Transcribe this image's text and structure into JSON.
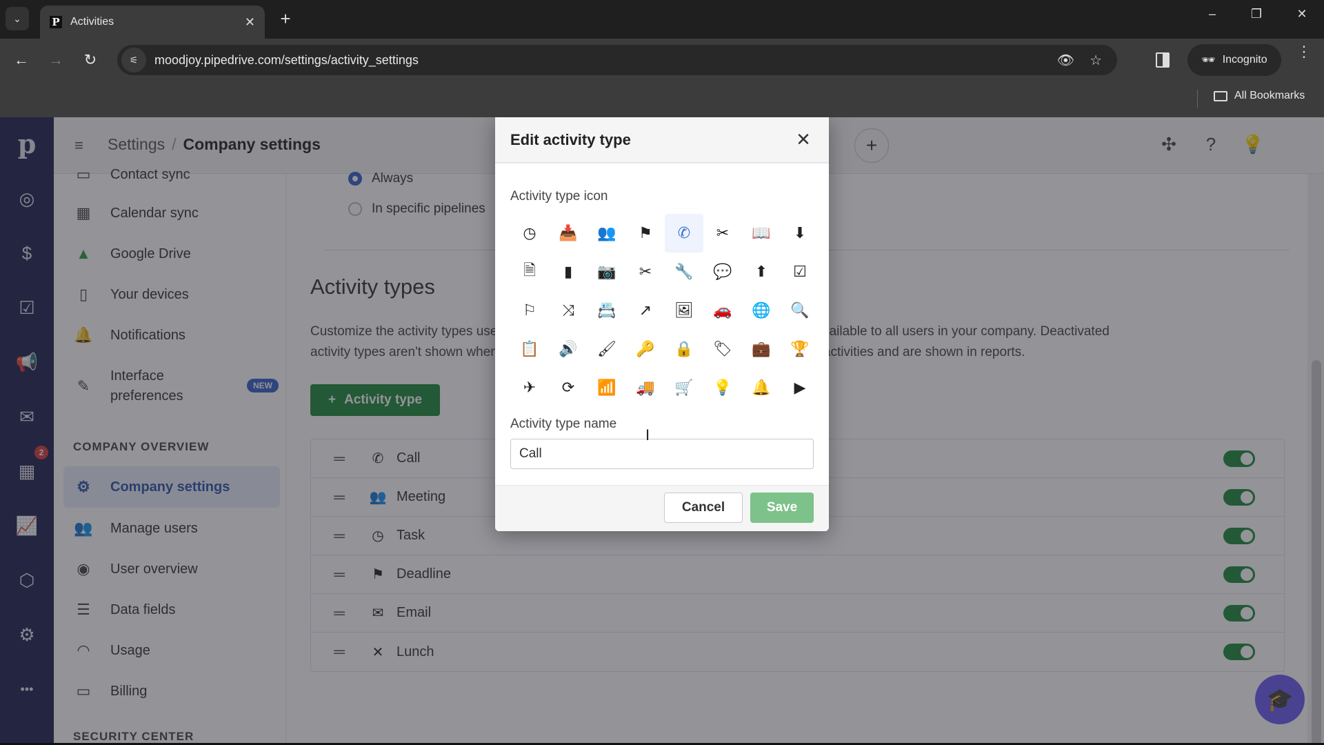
{
  "browser": {
    "tab_title": "Activities",
    "tab_favicon": "P",
    "url": "moodjoy.pipedrive.com/settings/activity_settings",
    "profile_label": "Incognito",
    "bookmarks_label": "All Bookmarks",
    "icons": {
      "tab_list": "⌄",
      "tab_close": "✕",
      "new_tab": "+",
      "minimize": "–",
      "restore": "❐",
      "close": "✕",
      "back": "←",
      "forward": "→",
      "reload": "↻",
      "site_settings": "⚟",
      "eye_off": "👁",
      "star": "☆",
      "kebab": "⋮"
    }
  },
  "header": {
    "breadcrumb_parent": "Settings",
    "breadcrumb_sep": "/",
    "breadcrumb_current": "Company settings",
    "icons": {
      "menu": "≡",
      "add": "+",
      "extensions": "✣",
      "help": "?",
      "ideas": "💡"
    }
  },
  "leftnav": {
    "logo": "p",
    "items": [
      {
        "name": "leads",
        "glyph": "◎"
      },
      {
        "name": "deals",
        "glyph": "$"
      },
      {
        "name": "projects",
        "glyph": "☑"
      },
      {
        "name": "campaigns",
        "glyph": "📢"
      },
      {
        "name": "mail",
        "glyph": "✉"
      },
      {
        "name": "activities",
        "glyph": "▦",
        "badge": "2"
      },
      {
        "name": "insights",
        "glyph": "📈"
      },
      {
        "name": "products",
        "glyph": "⬡"
      },
      {
        "name": "marketplace",
        "glyph": "⚙"
      },
      {
        "name": "more",
        "glyph": "•••"
      }
    ]
  },
  "settings_sidebar": {
    "items": [
      {
        "label": "Contact sync",
        "glyph": "▭"
      },
      {
        "label": "Calendar sync",
        "glyph": "▦"
      },
      {
        "label": "Google Drive",
        "glyph": "▲"
      },
      {
        "label": "Your devices",
        "glyph": "▯"
      },
      {
        "label": "Notifications",
        "glyph": "🔔"
      },
      {
        "label": "Interface preferences",
        "glyph": "✎",
        "badge": "NEW"
      }
    ],
    "section_heading": "COMPANY OVERVIEW",
    "company_items": [
      {
        "label": "Company settings",
        "glyph": "⚙",
        "active": true
      },
      {
        "label": "Manage users",
        "glyph": "👥"
      },
      {
        "label": "User overview",
        "glyph": "◉"
      },
      {
        "label": "Data fields",
        "glyph": "☰"
      },
      {
        "label": "Usage",
        "glyph": "◠"
      },
      {
        "label": "Billing",
        "glyph": "▭"
      }
    ],
    "next_section_heading": "SECURITY CENTER"
  },
  "main": {
    "radio_options": [
      {
        "label": "Always",
        "selected": true
      },
      {
        "label": "In specific pipelines",
        "selected": false
      }
    ],
    "section_title": "Activity types",
    "description_line1": "Customize the activity types used in your company. Activity types marked as active are available to all users in your company. Deactivated",
    "description_line2": "activity types aren't shown when scheduling new activities but are still visible for existing activities and are shown in reports.",
    "add_button_label": "Activity type",
    "add_button_icon": "+",
    "activity_types": [
      {
        "name": "Call",
        "glyph": "✆",
        "active": true
      },
      {
        "name": "Meeting",
        "glyph": "👥",
        "active": true
      },
      {
        "name": "Task",
        "glyph": "◷",
        "active": true
      },
      {
        "name": "Deadline",
        "glyph": "⚑",
        "active": true
      },
      {
        "name": "Email",
        "glyph": "✉",
        "active": true
      },
      {
        "name": "Lunch",
        "glyph": "✕",
        "active": true
      }
    ],
    "drag_glyph": "═"
  },
  "dialog": {
    "title": "Edit activity type",
    "close_glyph": "✕",
    "icon_label": "Activity type icon",
    "icons": [
      {
        "name": "clock",
        "glyph": "◷"
      },
      {
        "name": "inbox",
        "glyph": "📥"
      },
      {
        "name": "people",
        "glyph": "👥"
      },
      {
        "name": "flag",
        "glyph": "⚑"
      },
      {
        "name": "phone",
        "glyph": "✆",
        "selected": true
      },
      {
        "name": "fork-knife",
        "glyph": "✂"
      },
      {
        "name": "book",
        "glyph": "📖"
      },
      {
        "name": "archive-download",
        "glyph": "⬇"
      },
      {
        "name": "document",
        "glyph": "🗎"
      },
      {
        "name": "mobile",
        "glyph": "▮"
      },
      {
        "name": "camera",
        "glyph": "📷"
      },
      {
        "name": "scissors",
        "glyph": "✂"
      },
      {
        "name": "wrench",
        "glyph": "🔧"
      },
      {
        "name": "chat",
        "glyph": "💬"
      },
      {
        "name": "archive-upload",
        "glyph": "⬆"
      },
      {
        "name": "checkbox",
        "glyph": "☑"
      },
      {
        "name": "signpost",
        "glyph": "⚐"
      },
      {
        "name": "shuffle",
        "glyph": "⤨"
      },
      {
        "name": "contact-book",
        "glyph": "📇"
      },
      {
        "name": "trend",
        "glyph": "↗"
      },
      {
        "name": "image",
        "glyph": "🖼"
      },
      {
        "name": "car",
        "glyph": "🚗"
      },
      {
        "name": "globe",
        "glyph": "🌐"
      },
      {
        "name": "search",
        "glyph": "🔍"
      },
      {
        "name": "clipboard",
        "glyph": "📋"
      },
      {
        "name": "speaker",
        "glyph": "🔊"
      },
      {
        "name": "brush",
        "glyph": "🖌"
      },
      {
        "name": "key",
        "glyph": "🔑"
      },
      {
        "name": "lock",
        "glyph": "🔒"
      },
      {
        "name": "tag",
        "glyph": "🏷"
      },
      {
        "name": "briefcase",
        "glyph": "💼"
      },
      {
        "name": "trophy",
        "glyph": "🏆"
      },
      {
        "name": "airplane",
        "glyph": "✈"
      },
      {
        "name": "sync",
        "glyph": "⟳"
      },
      {
        "name": "wifi",
        "glyph": "📶"
      },
      {
        "name": "truck",
        "glyph": "🚚"
      },
      {
        "name": "cart",
        "glyph": "🛒"
      },
      {
        "name": "bulb",
        "glyph": "💡"
      },
      {
        "name": "bell",
        "glyph": "🔔"
      },
      {
        "name": "play",
        "glyph": "▶"
      }
    ],
    "name_label": "Activity type name",
    "name_value": "Call",
    "cancel_label": "Cancel",
    "save_label": "Save"
  },
  "fab_glyph": "🎓"
}
